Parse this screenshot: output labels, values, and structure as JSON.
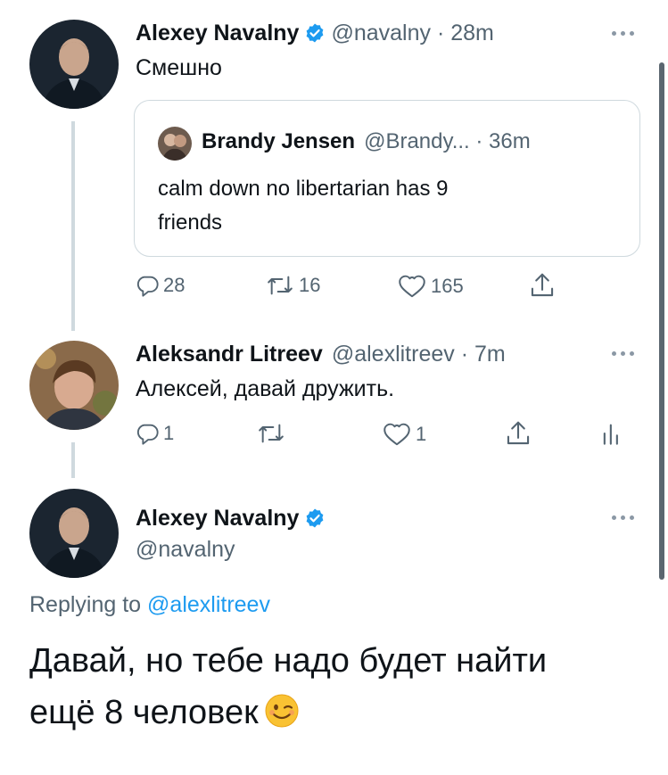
{
  "colors": {
    "accent": "#1d9bf0",
    "text": "#0f1419",
    "muted": "#536471",
    "border": "#cfd9de"
  },
  "tweet1": {
    "author_name": "Alexey Navalny",
    "handle_time": "@navalny · 28m",
    "text": "Смешно",
    "quote": {
      "author_name": "Brandy Jensen",
      "handle_time": "@Brandy... · 36m",
      "text_line1": "calm down no libertarian has 9",
      "text_line2": "friends"
    },
    "actions": {
      "reply_count": "28",
      "retweet_count": "16",
      "like_count": "165"
    }
  },
  "tweet2": {
    "author_name": "Aleksandr Litreev",
    "handle_time": "@alexlitreev · 7m",
    "text": "Алексей, давай дружить.",
    "actions": {
      "reply_count": "1",
      "retweet_count": "",
      "like_count": "1"
    }
  },
  "tweet3": {
    "author_name": "Alexey Navalny",
    "handle": "@navalny",
    "replying_prefix": "Replying to",
    "replying_to": "@alexlitreev",
    "text_line1": "Давай, но тебе надо будет найти",
    "text_line2": "ещё 8 человек"
  },
  "icons": [
    "verified-badge-icon",
    "more-icon",
    "reply-icon",
    "retweet-icon",
    "like-icon",
    "share-icon",
    "analytics-icon",
    "winking-face-emoji"
  ]
}
